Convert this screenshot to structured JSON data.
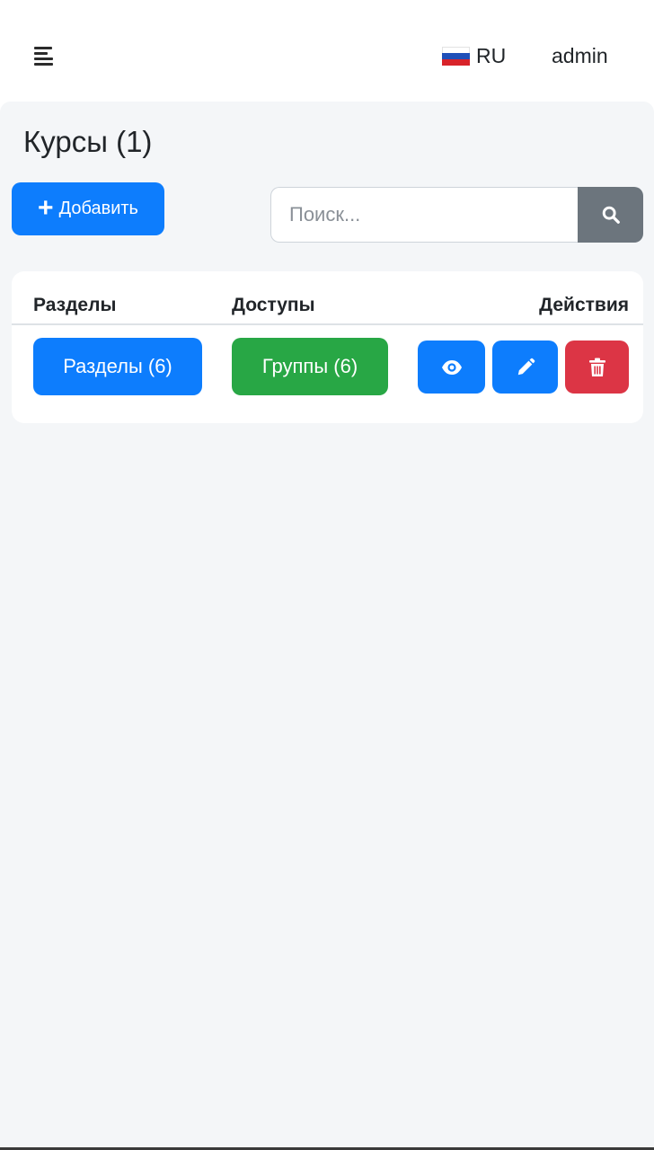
{
  "header": {
    "menu_icon": "hamburger-icon",
    "language": {
      "code": "RU",
      "flag_icon": "russia-flag-icon"
    },
    "username": "admin"
  },
  "page": {
    "title": "Курсы (1)"
  },
  "toolbar": {
    "add_label": "Добавить",
    "add_icon": "plus-icon",
    "search": {
      "placeholder": "Поиск...",
      "value": "",
      "button_icon": "search-icon"
    }
  },
  "table": {
    "headers": [
      "Разделы",
      "Доступы",
      "Действия"
    ],
    "rows": [
      {
        "sections_label": "Разделы (6)",
        "groups_label": "Группы (6)",
        "actions": [
          "eye-icon",
          "pencil-icon",
          "trash-icon"
        ]
      }
    ]
  },
  "colors": {
    "primary": "#0d7dfd",
    "success": "#28a745",
    "danger": "#dc3545",
    "secondary": "#6c757d",
    "background": "#f4f6f8"
  }
}
